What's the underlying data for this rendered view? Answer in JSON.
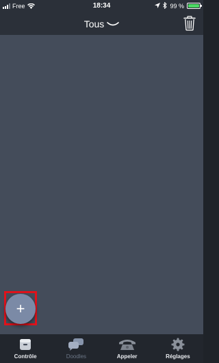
{
  "status_bar": {
    "carrier": "Free",
    "time": "18:34",
    "battery_percent": "99 %",
    "battery_level": 0.99
  },
  "header": {
    "title": "Tous",
    "title_icon": "chevron-down-icon",
    "action_icon": "trash-icon"
  },
  "fab": {
    "label": "+",
    "icon": "add-icon"
  },
  "tabs": [
    {
      "label": "Contrôle",
      "icon": "controller-icon",
      "active": true
    },
    {
      "label": "Doodles",
      "icon": "chat-bubbles-icon",
      "active": false
    },
    {
      "label": "Appeler",
      "icon": "phone-icon",
      "active": false
    },
    {
      "label": "Réglages",
      "icon": "gear-icon",
      "active": false
    }
  ],
  "colors": {
    "background": "#444c5a",
    "bar": "#2b3039",
    "tabbar": "#22262d",
    "fab": "#7b8aa6",
    "highlight": "#e0121b",
    "battery": "#4cd964"
  }
}
